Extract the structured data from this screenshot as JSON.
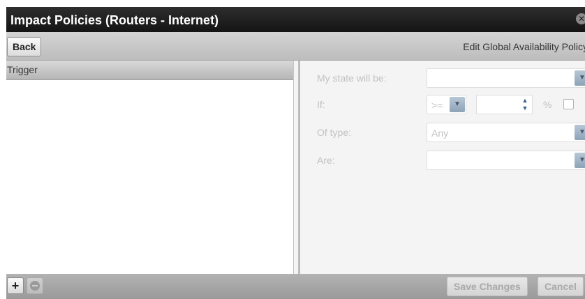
{
  "window": {
    "title": "Impact Policies (Routers - Internet)",
    "close_glyph": "✕"
  },
  "toolbar": {
    "back_label": "Back",
    "edit_title": "Edit Global Availability Policy"
  },
  "list": {
    "header": "Trigger",
    "items": []
  },
  "form": {
    "state_label": "My state will be:",
    "state_value": "",
    "if_label": "If:",
    "operator_value": ">=",
    "threshold_value": "",
    "percent_label": "%",
    "percent_checked": false,
    "type_label": "Of type:",
    "type_value": "Any",
    "are_label": "Are:",
    "are_value": ""
  },
  "bottom": {
    "add_glyph": "+",
    "save_label": "Save Changes",
    "cancel_label": "Cancel"
  },
  "icons": {
    "dropdown_arrow": "chevron-down-icon",
    "spinner": "up-down-arrows-icon",
    "close": "close-icon",
    "add": "plus-icon",
    "remove": "minus-icon"
  }
}
